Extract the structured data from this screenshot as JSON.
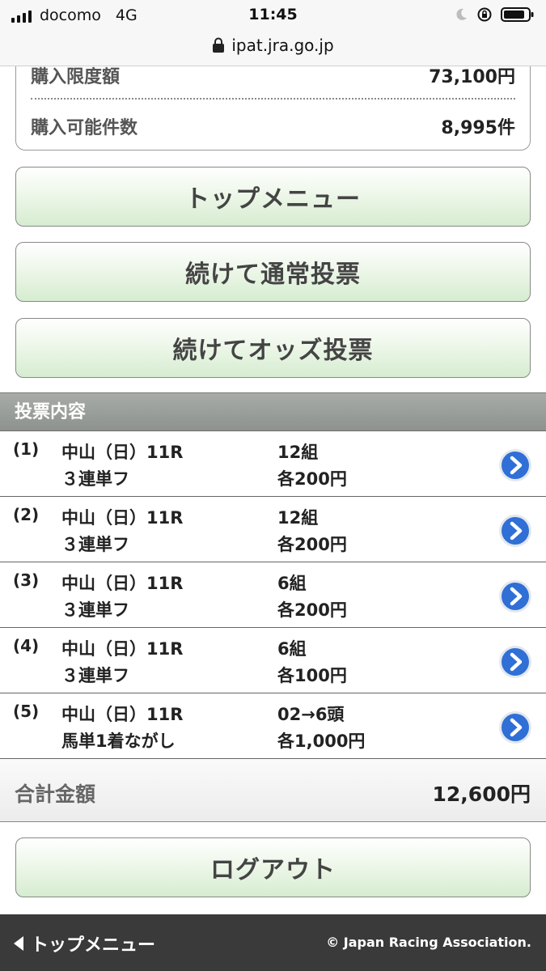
{
  "status_bar": {
    "carrier": "docomo",
    "network": "4G",
    "time": "11:45"
  },
  "url_bar": {
    "domain": "ipat.jra.go.jp"
  },
  "info": {
    "purchase_limit_label": "購入限度額",
    "purchase_limit_value": "73,100円",
    "purchasable_count_label": "購入可能件数",
    "purchasable_count_value": "8,995件"
  },
  "buttons": {
    "top_menu": "トップメニュー",
    "continue_normal": "続けて通常投票",
    "continue_odds": "続けてオッズ投票",
    "logout": "ログアウト"
  },
  "section": {
    "title": "投票内容"
  },
  "bets": [
    {
      "num": "(1)",
      "race": "中山（日）11R",
      "type": "３連単フ",
      "combos": "12組",
      "amount": "各200円"
    },
    {
      "num": "(2)",
      "race": "中山（日）11R",
      "type": "３連単フ",
      "combos": "12組",
      "amount": "各200円"
    },
    {
      "num": "(3)",
      "race": "中山（日）11R",
      "type": "３連単フ",
      "combos": "6組",
      "amount": "各200円"
    },
    {
      "num": "(4)",
      "race": "中山（日）11R",
      "type": "３連単フ",
      "combos": "6組",
      "amount": "各100円"
    },
    {
      "num": "(5)",
      "race": "中山（日）11R",
      "type": "馬単1着ながし",
      "combos": "02→6頭",
      "amount": "各1,000円"
    }
  ],
  "total": {
    "label": "合計金額",
    "value": "12,600円"
  },
  "footer": {
    "back_label": "トップメニュー",
    "copyright": "© Japan Racing Association."
  },
  "colors": {
    "button_green": "#d6ecd0",
    "header_gray": "#999c99",
    "footer_dark": "#3a3a3a",
    "arrow_blue": "#2f6fd6"
  },
  "icons": [
    "signal-icon",
    "moon-icon",
    "rotation-lock-icon",
    "battery-icon",
    "lock-icon",
    "chevron-right-circle-icon",
    "back-triangle-icon"
  ]
}
